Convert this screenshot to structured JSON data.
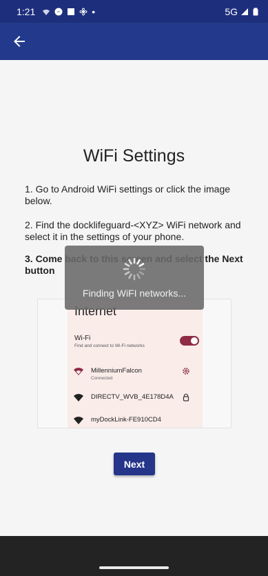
{
  "status_bar": {
    "time": "1:21",
    "network": "5G",
    "dot": "•"
  },
  "app_bar": {
    "back_icon": "arrow-left-icon"
  },
  "page": {
    "title": "WiFi Settings",
    "step1": "1. Go to Android WiFi settings or click the image below.",
    "step2": "2. Find the docklifeguard-<XYZ> WiFi network and select it in the settings of your phone.",
    "step3": "3. Come back to this screen and select the Next button",
    "next_label": "Next"
  },
  "wifi_image": {
    "title": "Internet",
    "wifi_label": "Wi-Fi",
    "wifi_sub": "Find and connect to Wi-Fi networks",
    "toggle_on": true,
    "networks": [
      {
        "name": "MillenniumFalcon",
        "sub": "Connected",
        "trail_icon": "gear-icon"
      },
      {
        "name": "DIRECTV_WVB_4E178D4A",
        "sub": "",
        "trail_icon": "lock-icon"
      },
      {
        "name": "myDockLink-FE910CD4",
        "sub": "",
        "trail_icon": ""
      }
    ]
  },
  "overlay": {
    "message": "Finding WiFI networks..."
  },
  "colors": {
    "primary": "#233a8c",
    "status_bar": "#1d2f7c",
    "accent": "#8f2b44",
    "panel_bg": "#f9ece9"
  }
}
